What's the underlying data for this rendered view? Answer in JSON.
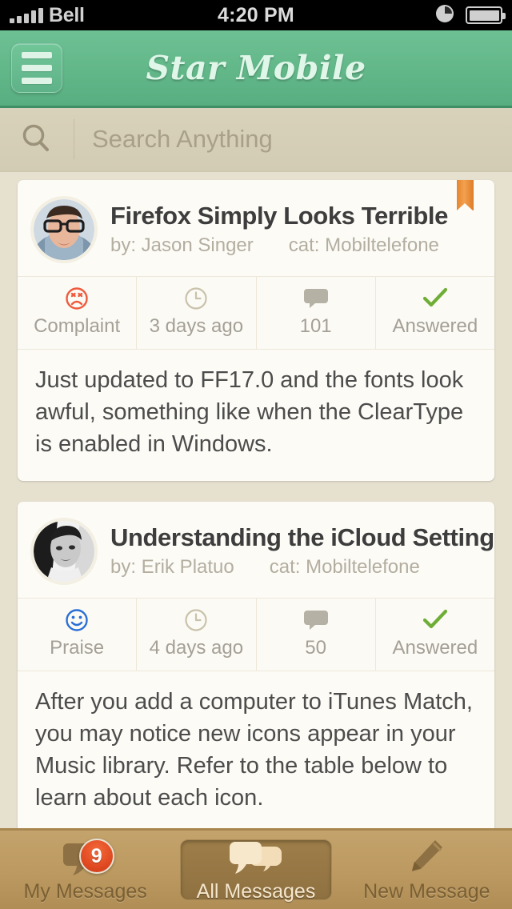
{
  "statusbar": {
    "carrier": "Bell",
    "time": "4:20 PM",
    "signal_icon": "signal-bars-icon",
    "clock_icon": "clock-icon",
    "battery_icon": "battery-icon"
  },
  "navbar": {
    "title": "Star Mobile",
    "menu_icon": "hamburger-menu-icon",
    "accent_color": "#63b88a"
  },
  "search": {
    "placeholder": "Search Anything",
    "value": "",
    "icon": "search-icon"
  },
  "feed": {
    "cards": [
      {
        "title": "Firefox Simply Looks Terrible",
        "author": "by: Jason Singer",
        "category": "cat: Mobiltelefone",
        "avatar_name": "avatar-jason-singer",
        "bookmarked": true,
        "bookmark_color": "#e5862f",
        "meta": [
          {
            "icon": "sad-face-icon",
            "icon_color": "#f05a3c",
            "label": "Complaint"
          },
          {
            "icon": "clock-icon",
            "icon_color": "#c9c2ab",
            "label": "3 days ago"
          },
          {
            "icon": "comment-bubble-icon",
            "icon_color": "#b5b1a4",
            "label": "101"
          },
          {
            "icon": "check-mark-icon",
            "icon_color": "#6fae36",
            "label": "Answered"
          }
        ],
        "body": "Just updated to FF17.0 and the fonts look awful, something like when the ClearType is enabled in Windows."
      },
      {
        "title": "Understanding the iCloud Setting",
        "author": "by: Erik Platuo",
        "category": "cat: Mobiltelefone",
        "avatar_name": "avatar-erik-platuo",
        "bookmarked": false,
        "bookmark_color": "#e5862f",
        "meta": [
          {
            "icon": "smiley-face-icon",
            "icon_color": "#2a6fd6",
            "label": "Praise"
          },
          {
            "icon": "clock-icon",
            "icon_color": "#c9c2ab",
            "label": "4 days ago"
          },
          {
            "icon": "comment-bubble-icon",
            "icon_color": "#b5b1a4",
            "label": "50"
          },
          {
            "icon": "check-mark-icon",
            "icon_color": "#6fae36",
            "label": "Answered"
          }
        ],
        "body": "After you add a computer to iTunes Match, you may notice new icons appear in your Music library. Refer to the table below to learn about each icon."
      }
    ]
  },
  "tabbar": {
    "tabs": [
      {
        "label": "My Messages",
        "icon": "speech-bubble-icon",
        "active": false,
        "badge": "9"
      },
      {
        "label": "All Messages",
        "icon": "double-speech-bubble-icon",
        "active": true,
        "badge": ""
      },
      {
        "label": "New Message",
        "icon": "pencil-icon",
        "active": false,
        "badge": ""
      }
    ]
  }
}
